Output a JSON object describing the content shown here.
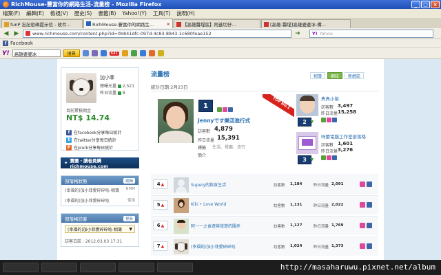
{
  "window": {
    "title": "RichMouse-豐富你的網路生活-流量榜 - Mozilla Firefox"
  },
  "menu": [
    "檔案(F)",
    "編輯(E)",
    "檢視(V)",
    "歷史(S)",
    "書籤(B)",
    "Yahoo!(Y)",
    "工具(T)",
    "說明(H)"
  ],
  "tabs": [
    {
      "label": "funP 忘記密碼提示信 - 收件..."
    },
    {
      "label": "RichMouse-豐富你的網路生..."
    },
    {
      "label": "【高雄醫埕區】阿進切仔..."
    },
    {
      "label": "[高雄-醫埕]高雄婆婆冰-備..."
    }
  ],
  "nav": {
    "url": "www.richmouse.com/content.php?id=0b841dfc-097d-4c83-8843-1c680feae152",
    "search_placeholder": "Yahoo"
  },
  "bookmarks": {
    "facebook": "Facebook"
  },
  "yahoo_bar": {
    "query": "高雄婆婆冰",
    "search_btn": "搜尋",
    "badge": "641"
  },
  "profile": {
    "name": "加小菲",
    "stat1_label": "總曝光量",
    "stat1_value": "2,521",
    "stat2_label": "昨日流量",
    "stat2_value": "8",
    "income_label": "目前累積佣金",
    "income": "NT$ 14.74",
    "share_fb": "在facebook分享每日統計",
    "share_tw": "在twitter分享每日統計",
    "share_plurk": "在plurk分享每日統計"
  },
  "banner": "賣團・讀者員購richmouse.com",
  "sect1": {
    "title": "部落格狀態",
    "btn": "編輯",
    "row1": "(幸福的)加小菲愛碎碎唸-相簿",
    "row1_tag": "NMM",
    "row2": "(幸福的)加小菲愛碎碎唸",
    "row2_tag": "使用"
  },
  "sect2": {
    "title": "部落格訪客",
    "btn": "更新",
    "select": "(幸福的)加小菲愛碎碎唸-相簿",
    "row1": "訪客日誌 : 2012.03.03 17:31"
  },
  "main": {
    "title": "流量榜",
    "tab_album": "相簿",
    "tab_site": "網誌",
    "tab_new": "新網誌",
    "date": "統計日期:2月23日"
  },
  "top1": {
    "rank": "1",
    "ribbon": "TOP No.1",
    "name": "Jennyです樂活進行式",
    "visitors_label": "訪客數",
    "visitors": "4,879",
    "day_label": "昨日流量",
    "day": "15,391",
    "tags_label": "標籤",
    "tags": "生活、餐廳、流行",
    "intro_label": "簡介"
  },
  "top2": {
    "rank": "2",
    "name": "雋雋小幫",
    "visitors_label": "訪客數",
    "visitors": "3,497",
    "day_label": "昨日流量",
    "day": "15,258"
  },
  "top3": {
    "rank": "3",
    "name": "呀蕾電腦工作室部落格",
    "visitors_label": "訪客數",
    "visitors": "1,601",
    "day_label": "昨日流量",
    "day": "3,276"
  },
  "list": [
    {
      "rank": "4",
      "name": "Supery的飲食生活",
      "visitors": "1,184",
      "day": "2,091"
    },
    {
      "rank": "5",
      "name": "Kiki • Love World",
      "visitors": "1,131",
      "day": "2,022"
    },
    {
      "rank": "6",
      "name": "阿一一之食遊與旅遊的闊步",
      "visitors": "1,127",
      "day": "1,769"
    },
    {
      "rank": "7",
      "name": "(幸福的)加小菲愛碎碎唸",
      "visitors": "1,024",
      "day": "1,373"
    }
  ],
  "list_labels": {
    "visitors": "訪客數",
    "day": "昨日流量"
  },
  "watermark": "http://masaharuwu.pixnet.net/album"
}
